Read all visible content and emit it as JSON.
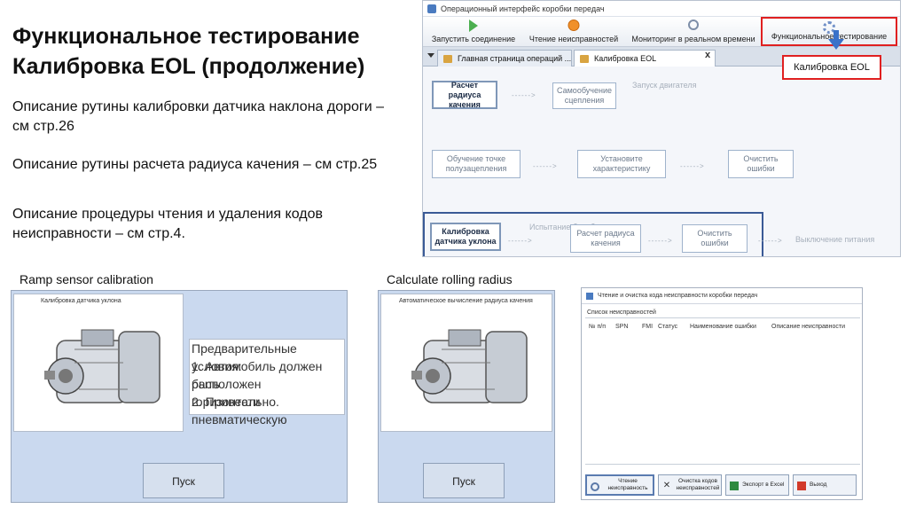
{
  "slide": {
    "title_line1": "Функциональное тестирование",
    "title_line2": "Калибровка EOL (продолжение)",
    "desc1": "Описание рутины калибровки датчика наклона дороги – см стр.26",
    "desc2": "Описание рутины расчета радиуса качения – см стр.25",
    "desc3": "Описание процедуры чтения и удаления кодов неисправности – см стр.4."
  },
  "app": {
    "window_title": "Операционный интерфейс коробки передач",
    "toolbar": {
      "connect": "Запустить соединение",
      "read_faults": "Чтение неисправностей",
      "monitoring": "Мониторинг в реальном времени",
      "functional_test": "Функциональное тестирование"
    },
    "tabs": [
      {
        "label": "Главная страница операций ..."
      },
      {
        "label": "Калибровка EOL"
      }
    ],
    "tab_close": "x",
    "callout": "Калибровка EOL",
    "flow": {
      "rolling_radius": "Расчет радиуса качения",
      "clutch_learn": "Самообучение сцепления",
      "engine_start": "Запуск двигателя",
      "touchpoint_learn": "Обучение точке полузацепления",
      "set_char": "Установите характеристику",
      "clear_errors_1": "Очистить ошибки",
      "ramp_calib": "Калибровка датчика уклона",
      "drum_test": "Испытание барабана",
      "rolling_radius_2": "Расчет радиуса качения",
      "clear_errors_2": "Очистить ошибки",
      "power_off": "Выключение питания",
      "arrow": "------>"
    }
  },
  "ramp_panel": {
    "caption": "Ramp sensor calibration",
    "window_title": "Калибровка датчика уклона",
    "preconditions": [
      "Предварительные условия:",
      "1. Автомобиль должен быть",
      "расположен горизонтально.",
      "2. Привести",
      "пневматическую"
    ],
    "button": "Пуск"
  },
  "radius_panel": {
    "caption": "Calculate rolling radius",
    "window_title": "Автоматическое вычисление радиуса качения",
    "button": "Пуск"
  },
  "fault_panel": {
    "window_title": "Чтение и очистка  кода неисправности коробки передач",
    "list_label": "Список неисправностей",
    "columns": [
      "№ п/п",
      "SPN",
      "FMI",
      "Статус",
      "Наименование ошибки",
      "Описание неисправности"
    ],
    "buttons": [
      {
        "label": "Чтение неисправность"
      },
      {
        "label": "Очистка кодов неисправностей"
      },
      {
        "label": "Экспорт в Excel"
      },
      {
        "label": "Выход"
      }
    ]
  }
}
